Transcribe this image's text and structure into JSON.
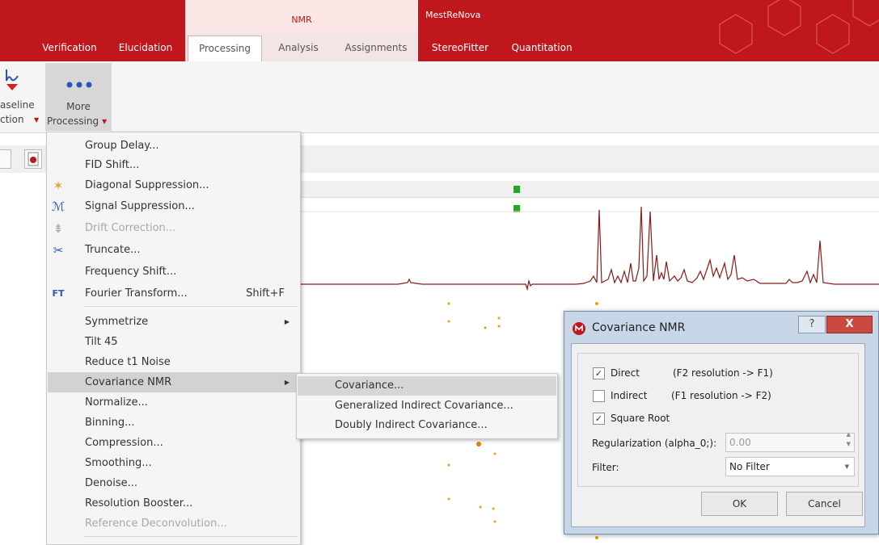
{
  "context_labels": {
    "nmr": "NMR",
    "mestrenova": "MestReNova"
  },
  "tabs": [
    {
      "label": "Verification"
    },
    {
      "label": "Elucidation"
    },
    {
      "label": "Processing"
    },
    {
      "label": "Analysis"
    },
    {
      "label": "Assignments"
    },
    {
      "label": "StereoFitter"
    },
    {
      "label": "Quantitation"
    }
  ],
  "ribbon": {
    "baseline_line1": "aseline",
    "baseline_line2": "ction",
    "more_line1": "More",
    "more_line2": "Processing"
  },
  "menu": {
    "items": [
      {
        "label": "Group Delay...",
        "icon": "",
        "disabled": false
      },
      {
        "label": "FID Shift...",
        "icon": "",
        "disabled": false
      },
      {
        "label": "Diagonal Suppression...",
        "icon": "diagonal-suppression-icon",
        "disabled": false
      },
      {
        "label": "Signal Suppression...",
        "icon": "signal-suppression-icon",
        "disabled": false
      },
      {
        "label": "Drift Correction...",
        "icon": "drift-correction-icon",
        "disabled": true
      },
      {
        "label": "Truncate...",
        "icon": "truncate-icon",
        "disabled": false
      },
      {
        "label": "Frequency Shift...",
        "icon": "",
        "disabled": false
      },
      {
        "label": "Fourier Transform...",
        "icon": "fourier-transform-icon",
        "disabled": false,
        "shortcut": "Shift+F"
      },
      {
        "label": "Symmetrize",
        "icon": "",
        "disabled": false,
        "submenu": true
      },
      {
        "label": "Tilt 45",
        "icon": "",
        "disabled": false
      },
      {
        "label": "Reduce t1 Noise",
        "icon": "",
        "disabled": false
      },
      {
        "label": "Covariance NMR",
        "icon": "",
        "disabled": false,
        "submenu": true,
        "highlighted": true
      },
      {
        "label": "Normalize...",
        "icon": "",
        "disabled": false
      },
      {
        "label": "Binning...",
        "icon": "",
        "disabled": false
      },
      {
        "label": "Compression...",
        "icon": "",
        "disabled": false
      },
      {
        "label": "Smoothing...",
        "icon": "",
        "disabled": false
      },
      {
        "label": "Denoise...",
        "icon": "",
        "disabled": false
      },
      {
        "label": "Resolution Booster...",
        "icon": "",
        "disabled": false
      },
      {
        "label": "Reference Deconvolution...",
        "icon": "",
        "disabled": true
      }
    ]
  },
  "submenu": {
    "items": [
      {
        "label": "Covariance..."
      },
      {
        "label": "Generalized Indirect Covariance..."
      },
      {
        "label": "Doubly Indirect Covariance..."
      }
    ]
  },
  "dialog": {
    "title": "Covariance NMR",
    "direct_label": "Direct",
    "direct_checked": true,
    "direct_note": "(F2 resolution -> F1)",
    "indirect_label": "Indirect",
    "indirect_checked": false,
    "indirect_note": "(F1 resolution -> F2)",
    "sqrt_label": "Square Root",
    "sqrt_checked": true,
    "regularization_label": "Regularization (alpha_0;):",
    "regularization_value": "0.00",
    "filter_label": "Filter:",
    "filter_value": "No Filter",
    "ok": "OK",
    "cancel": "Cancel",
    "help_glyph": "?",
    "close_glyph": "X"
  },
  "colors": {
    "brand": "#c0171c",
    "spectrum": "#8b1a1a",
    "peaks": "#f0a000",
    "green": "#22aa22"
  }
}
